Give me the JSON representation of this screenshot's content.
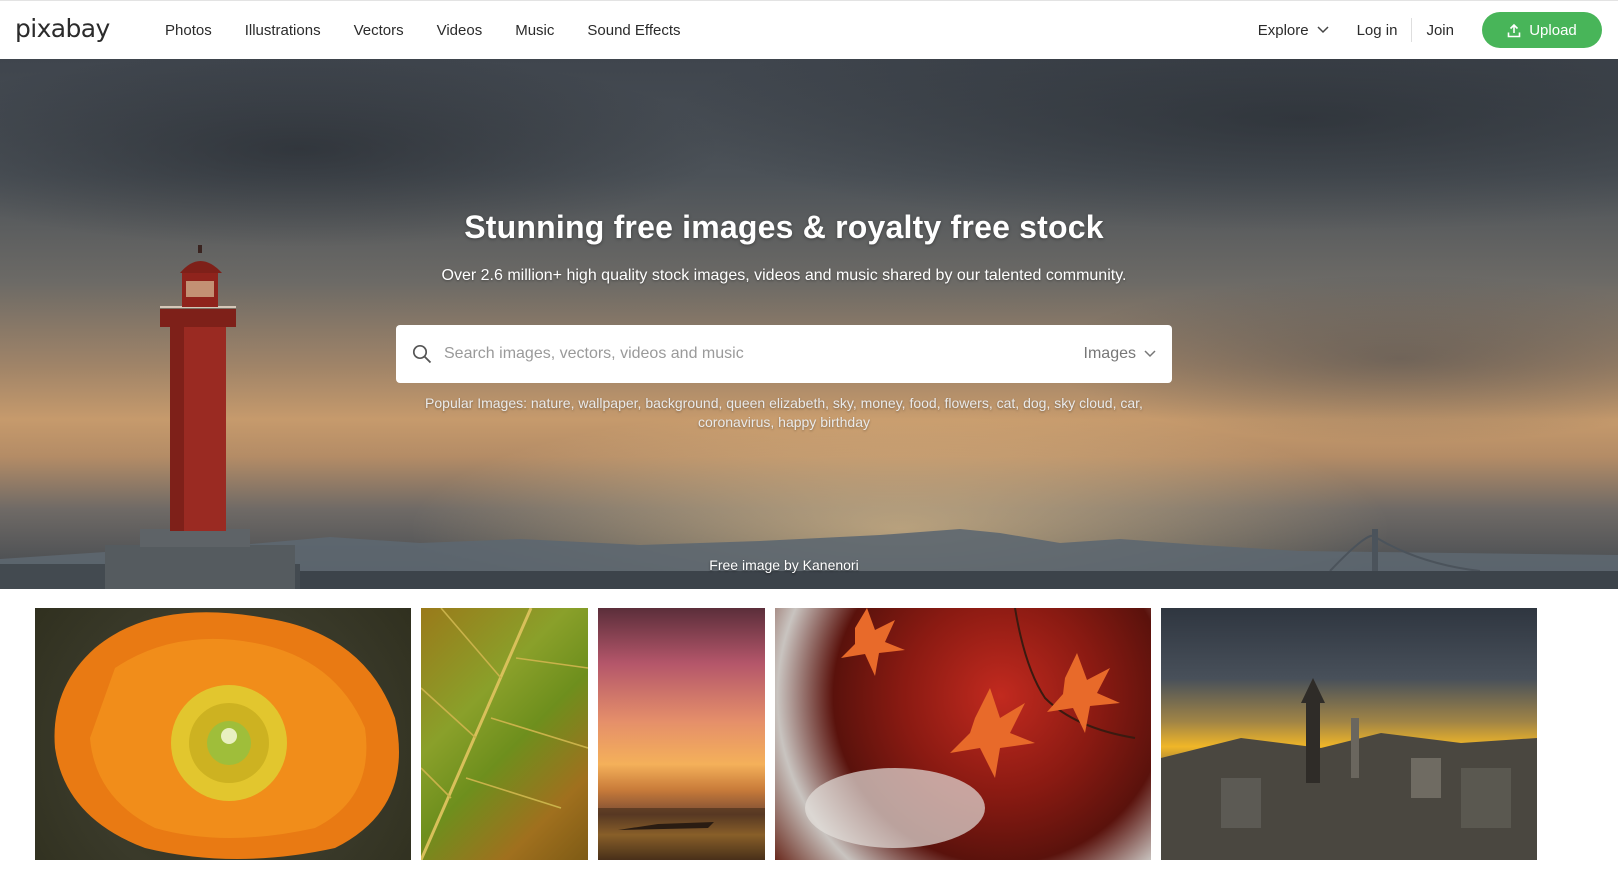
{
  "header": {
    "logo": "pixabay",
    "nav": [
      "Photos",
      "Illustrations",
      "Vectors",
      "Videos",
      "Music",
      "Sound Effects"
    ],
    "explore_label": "Explore",
    "login_label": "Log in",
    "join_label": "Join",
    "upload_label": "Upload",
    "accent_color": "#48b559"
  },
  "hero": {
    "title": "Stunning free images & royalty free stock",
    "subtitle": "Over 2.6 million+ high quality stock images, videos and music shared by our talented community.",
    "search_placeholder": "Search images, vectors, videos and music",
    "search_type": "Images",
    "popular_prefix": "Popular Images:",
    "popular_tags": [
      "nature",
      "wallpaper",
      "background",
      "queen elizabeth",
      "sky",
      "money",
      "food",
      "flowers",
      "cat",
      "dog",
      "sky cloud",
      "car",
      "coronavirus",
      "happy birthday"
    ],
    "credit": "Free image by Kanenori"
  },
  "gallery": {
    "thumbnails": [
      "orange-poppy",
      "green-leaf",
      "sunset-sea",
      "red-maple-leaves",
      "sunset-pagoda-city"
    ]
  }
}
